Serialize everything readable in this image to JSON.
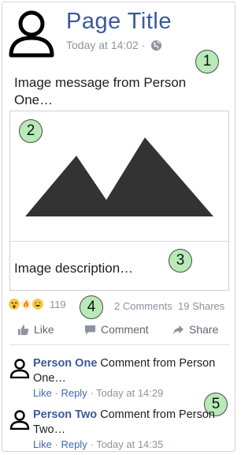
{
  "post": {
    "title": "Page Title",
    "time": "Today at 14:02",
    "separator": "·",
    "message": "Image message from Person One…",
    "image_description": "Image description…",
    "reaction_count": "119",
    "comments_count": "2 Comments",
    "shares_count": "19 Shares"
  },
  "actions": {
    "like": "Like",
    "comment": "Comment",
    "share": "Share"
  },
  "comments": [
    {
      "name": "Person One",
      "text": "Comment from Person One…",
      "like": "Like",
      "reply": "Reply",
      "time": "Today at 14:29",
      "dot": "·"
    },
    {
      "name": "Person Two",
      "text": "Comment from Person Two…",
      "like": "Like",
      "reply": "Reply",
      "time": "Today at 14:35",
      "dot": "·"
    }
  ],
  "badges": [
    "1",
    "2",
    "3",
    "4",
    "5"
  ],
  "colors": {
    "brand": "#3b5998",
    "link": "#4267b2",
    "muted": "#8d949e",
    "badge": "#b8eab8",
    "mountains": "#333333"
  },
  "icons": {
    "avatar": "person-icon",
    "globe": "globe-icon",
    "like": "thumbs-up-icon",
    "comment": "speech-bubble-icon",
    "share": "share-arrow-icon",
    "reactions": [
      "surprised-emoji-icon",
      "fire-emoji-icon",
      "laughing-emoji-icon"
    ]
  }
}
